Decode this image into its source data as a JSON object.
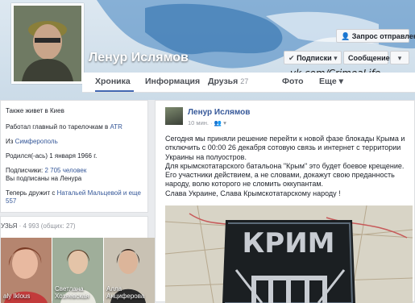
{
  "profile": {
    "name": "Ленур Ислямов"
  },
  "actions": {
    "friend_request": "Запрос отправлен",
    "subscriptions": "Подписки",
    "message": "Сообщение",
    "more": "▾"
  },
  "watermark": "vk.com/CrimeaLife",
  "tabs": [
    {
      "label": "Хроника",
      "count": ""
    },
    {
      "label": "Информация",
      "count": ""
    },
    {
      "label": "Друзья",
      "count": "27"
    },
    {
      "label": "Фото",
      "count": ""
    },
    {
      "label": "Еще",
      "count": ""
    }
  ],
  "about": {
    "lives": "Также живет в Киев",
    "job_prefix": "Работал главный по тарелочкам в ",
    "job_link": "ATR",
    "from_prefix": "Из ",
    "from_link": "Симферополь",
    "born": "Родился(-ась) 1 января 1966 г.",
    "subscribers_prefix": "Подписчики: ",
    "subscribers_link": "2 705 человек",
    "subscribed": "Вы подписаны на Ленура",
    "friends_with_prefix": "Теперь дружит с ",
    "friends_with_link": "Натальей Мальцевой и еще 557"
  },
  "friends": {
    "header_title": "УЗЬЯ",
    "header_count": "· 4 993 (общих: 27)",
    "items": [
      {
        "name_1": "aly Iklous",
        "name_2": ""
      },
      {
        "name_1": "Светлана",
        "name_2": "Хозяевская"
      },
      {
        "name_1": "Алла",
        "name_2": "Анциферова"
      }
    ]
  },
  "post": {
    "author": "Ленур Ислямов",
    "time": "10 мин. ·",
    "text_lines": [
      "Сегодня мы приняли решение перейти к новой фазе блокады Крыма и",
      "отключить с 00:00 26 декабря сотовую связь и интернет с территории",
      "Украины на полуостров.",
      "Для крымскотатарского батальона \"Крым\" это будет боевое крещение.",
      "Его участники действием, а не словами, докажут свою преданность",
      "народу, волю которого не сломить оккупантам.",
      "Слава Украине, Слава Крымскотатарскому народу !"
    ],
    "patch_text": "КРИМ"
  }
}
